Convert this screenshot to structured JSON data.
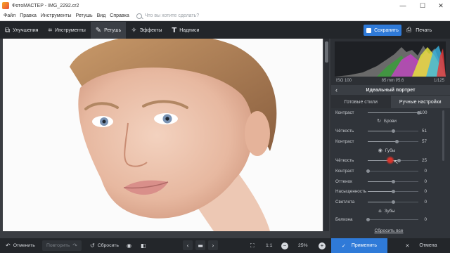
{
  "window": {
    "title": "ФотоМАСТЕР - IMG_2292.cr2",
    "controls": {
      "minimize": "—",
      "maximize": "☐",
      "close": "✕"
    }
  },
  "menu": {
    "items": [
      "Файл",
      "Правка",
      "Инструменты",
      "Ретушь",
      "Вид",
      "Справка"
    ],
    "search_placeholder": "Что вы хотите сделать?"
  },
  "toolbar": {
    "tabs": [
      {
        "label": "Улучшения",
        "icon": "layers-icon"
      },
      {
        "label": "Инструменты",
        "icon": "crop-icon"
      },
      {
        "label": "Ретушь",
        "icon": "brush-icon",
        "active": true
      },
      {
        "label": "Эффекты",
        "icon": "magic-wand-icon"
      },
      {
        "label": "Надписи",
        "icon": "text-icon"
      }
    ],
    "save_label": "Сохранить",
    "print_label": "Печать"
  },
  "histogram": {
    "iso": "ISO 100",
    "lens": "85 mm f/5.6",
    "shutter": "1/125"
  },
  "panel": {
    "preset_title": "Идеальный портрет",
    "subtabs": [
      "Готовые стили",
      "Ручные настройки"
    ],
    "active_subtab": 1,
    "sections": {
      "brows": "Брови",
      "lips": "Губы",
      "teeth": "Зубы"
    },
    "sliders": [
      {
        "label": "Контраст",
        "value": "100",
        "fraction": 1.0
      },
      {
        "label": "Чёткость",
        "value": "51",
        "fraction": 0.51
      },
      {
        "label": "Контраст",
        "value": "57",
        "fraction": 0.57
      },
      {
        "label": "Чёткость",
        "value": "25",
        "fraction": 0.62
      },
      {
        "label": "Контраст",
        "value": "0",
        "fraction": 0.0
      },
      {
        "label": "Оттенок",
        "value": "0",
        "fraction": 0.5
      },
      {
        "label": "Насыщенность",
        "value": "0",
        "fraction": 0.5
      },
      {
        "label": "Светлота",
        "value": "0",
        "fraction": 0.5
      },
      {
        "label": "Белизна",
        "value": "0",
        "fraction": 0.0
      }
    ],
    "reset_all": "Сбросить все"
  },
  "bottom": {
    "undo": "Отменить",
    "redo": "Повторить",
    "reset": "Сбросить",
    "zoom_ratio": "1:1",
    "zoom_level": "25%",
    "apply": "Применить",
    "cancel": "Отмена"
  }
}
